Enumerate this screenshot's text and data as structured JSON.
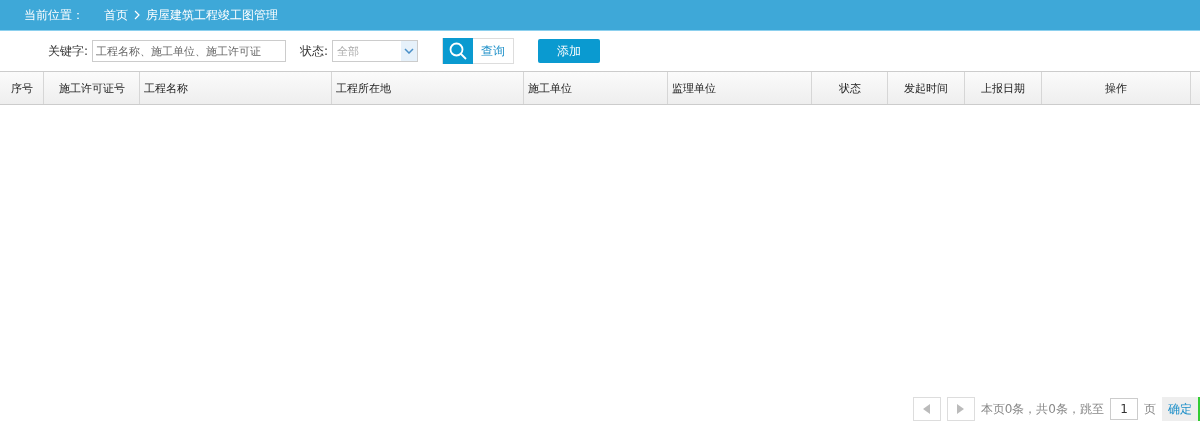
{
  "breadcrumb": {
    "label": "当前位置：",
    "items": [
      "首页",
      "房屋建筑工程竣工图管理"
    ]
  },
  "filters": {
    "keyword_label": "关键字:",
    "keyword_placeholder": "工程名称、施工单位、施工许可证",
    "status_label": "状态:",
    "status_value": "全部",
    "search_button": "查询",
    "add_button": "添加"
  },
  "table": {
    "columns": [
      "序号",
      "施工许可证号",
      "工程名称",
      "工程所在地",
      "施工单位",
      "监理单位",
      "状态",
      "发起时间",
      "上报日期",
      "操作"
    ]
  },
  "pagination": {
    "summary": "本页0条，共0条，跳至",
    "page_value": "1",
    "page_unit": "页",
    "confirm_button": "确定"
  }
}
